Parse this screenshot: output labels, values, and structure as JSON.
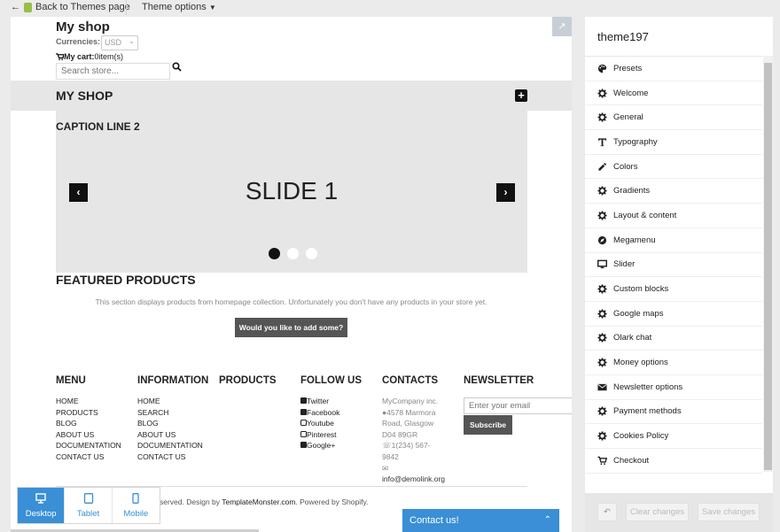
{
  "topbar": {
    "back_label": "Back to Themes page",
    "options_label": "Theme options"
  },
  "shop": {
    "name": "My shop",
    "currencies_label": "Currencies:",
    "currency_value": "USD",
    "cart_label": "My cart:",
    "cart_value": "0item(s)",
    "search_placeholder": "Search store...",
    "nav_title": "MY SHOP"
  },
  "slider": {
    "caption": "CAPTION LINE 2",
    "title": "SLIDE 1"
  },
  "featured": {
    "title": "FEATURED PRODUCTS",
    "description": "This section displays products from homepage collection. Unfortunately you don't have any products in your store yet.",
    "button": "Would you like to add some?"
  },
  "footer": {
    "menu": {
      "title": "MENU",
      "items": [
        "HOME",
        "PRODUCTS",
        "BLOG",
        "ABOUT US",
        "DOCUMENTATION",
        "CONTACT US"
      ]
    },
    "information": {
      "title": "INFORMATION",
      "items": [
        "HOME",
        "SEARCH",
        "BLOG",
        "ABOUT US",
        "DOCUMENTATION",
        "CONTACT US"
      ]
    },
    "products": {
      "title": "PRODUCTS"
    },
    "follow": {
      "title": "FOLLOW US",
      "items": [
        "Twitter",
        "Facebook",
        "Youtube",
        "Pinterest",
        "Google+"
      ]
    },
    "contacts": {
      "title": "CONTACTS",
      "company": "MyCompany inc.",
      "address1": "4578 Marmora",
      "address2": "Road, Glasgow",
      "address3": "D04 89GR",
      "phone1": "1(234) 567-",
      "phone2": "9842",
      "email": "info@demolink.org"
    },
    "newsletter": {
      "title": "NEWSLETTER",
      "placeholder": "Enter your email",
      "button": "Subscribe"
    },
    "copyright_pre": "served. Design by ",
    "copyright_link": "TemplateMonster.com",
    "copyright_post": ". Powered by Shopify."
  },
  "devices": [
    "Desktop",
    "Tablet",
    "Mobile"
  ],
  "contact_us": "Contact us!",
  "panel": {
    "title": "theme197",
    "items": [
      {
        "label": "Presets",
        "icon": "palette-icon"
      },
      {
        "label": "Welcome",
        "icon": "gear-icon"
      },
      {
        "label": "General",
        "icon": "gear-icon"
      },
      {
        "label": "Typography",
        "icon": "text-icon"
      },
      {
        "label": "Colors",
        "icon": "eyedropper-icon"
      },
      {
        "label": "Gradients",
        "icon": "gear-icon"
      },
      {
        "label": "Layout & content",
        "icon": "gear-icon"
      },
      {
        "label": "Megamenu",
        "icon": "compass-icon"
      },
      {
        "label": "Slider",
        "icon": "monitor-icon"
      },
      {
        "label": "Custom blocks",
        "icon": "gear-icon"
      },
      {
        "label": "Google maps",
        "icon": "gear-icon"
      },
      {
        "label": "Olark chat",
        "icon": "gear-icon"
      },
      {
        "label": "Money options",
        "icon": "gear-icon"
      },
      {
        "label": "Newsletter options",
        "icon": "envelope-icon"
      },
      {
        "label": "Payment methods",
        "icon": "gear-icon"
      },
      {
        "label": "Cookies Policy",
        "icon": "gear-icon"
      },
      {
        "label": "Checkout",
        "icon": "cart-icon"
      }
    ],
    "clear_label": "Clear changes",
    "save_label": "Save changes"
  }
}
